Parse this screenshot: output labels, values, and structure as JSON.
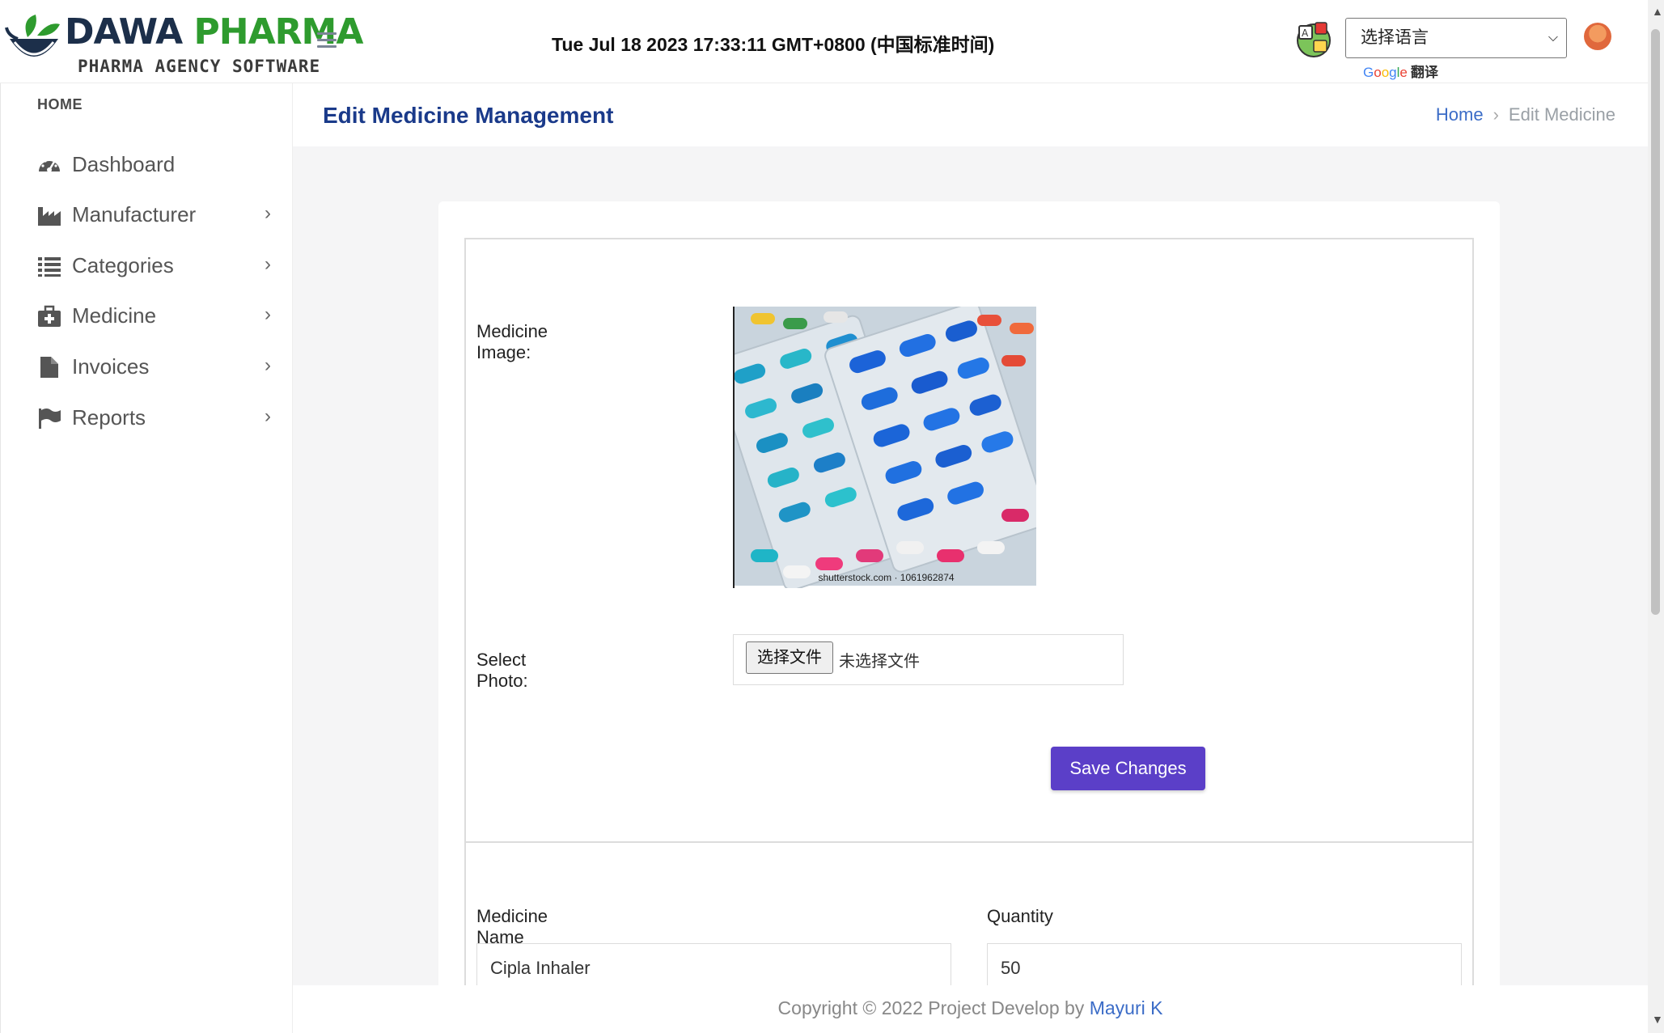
{
  "header": {
    "brand_word1": "DAWA",
    "brand_word2": "PHARMA",
    "tagline": "PHARMA AGENCY SOFTWARE",
    "datetime": "Tue Jul 18 2023 17:33:11 GMT+0800 (中国标准时间)",
    "language_select": "选择语言",
    "powered_brand": [
      "G",
      "o",
      "o",
      "g",
      "l",
      "e"
    ],
    "powered_label": "翻译"
  },
  "sidebar": {
    "heading": "HOME",
    "items": [
      {
        "label": "Dashboard",
        "icon": "dashboard-icon",
        "has_submenu": false
      },
      {
        "label": "Manufacturer",
        "icon": "industry-icon",
        "has_submenu": true
      },
      {
        "label": "Categories",
        "icon": "list-icon",
        "has_submenu": true
      },
      {
        "label": "Medicine",
        "icon": "medkit-icon",
        "has_submenu": true
      },
      {
        "label": "Invoices",
        "icon": "file-icon",
        "has_submenu": true
      },
      {
        "label": "Reports",
        "icon": "flag-icon",
        "has_submenu": true
      }
    ],
    "chevron": "›"
  },
  "page": {
    "title": "Edit Medicine Management",
    "breadcrumb_home": "Home",
    "breadcrumb_sep": "›",
    "breadcrumb_current": "Edit Medicine"
  },
  "form": {
    "image_label": "Medicine Image:",
    "image_caption": "shutterstock.com · 1061962874",
    "photo_label": "Select Photo:",
    "file_button": "选择文件",
    "file_status": "未选择文件",
    "save_button": "Save Changes",
    "name_label": "Medicine Name",
    "name_value": "Cipla Inhaler",
    "qty_label": "Quantity",
    "qty_value": "50"
  },
  "footer": {
    "text": "Copyright © 2022 Project Develop by",
    "author": "Mayuri K"
  },
  "colors": {
    "accent": "#5b3fc8",
    "title": "#1a3a8a",
    "link": "#3b6cc7",
    "brand_green": "#2e9b2e"
  }
}
